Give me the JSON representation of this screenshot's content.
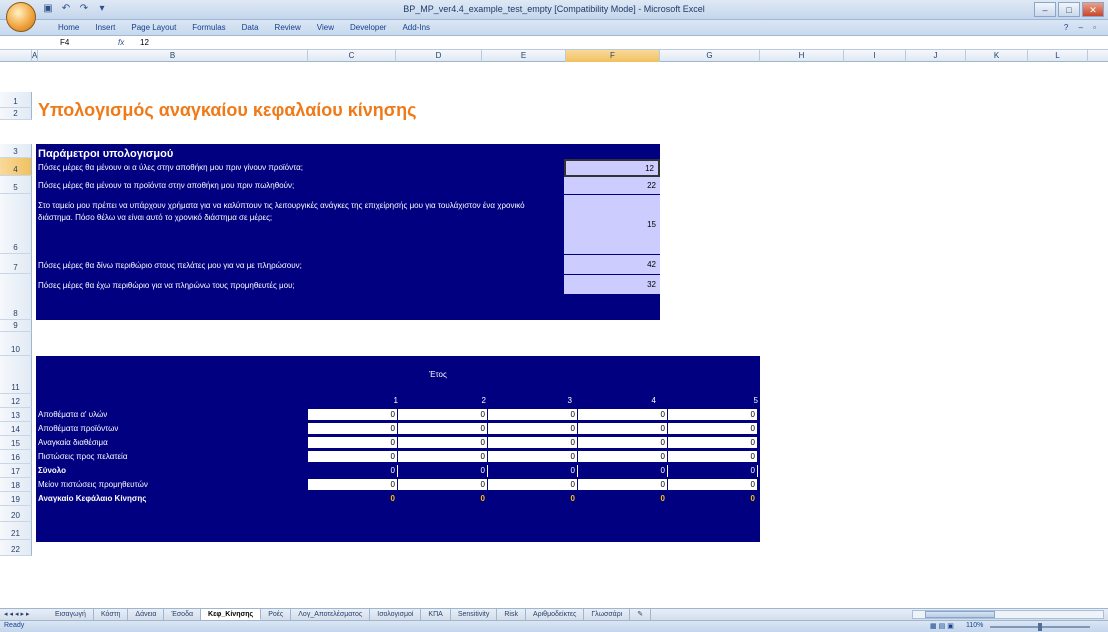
{
  "window": {
    "title": "BP_MP_ver4.4_example_test_empty  [Compatibility Mode] - Microsoft Excel"
  },
  "ribbon_tabs": [
    "Home",
    "Insert",
    "Page Layout",
    "Formulas",
    "Data",
    "Review",
    "View",
    "Developer",
    "Add-Ins"
  ],
  "formula_bar": {
    "cell_ref": "F4",
    "fx": "fx",
    "value": "12"
  },
  "columns": [
    "A",
    "B",
    "C",
    "D",
    "E",
    "F",
    "G",
    "H",
    "I",
    "J",
    "K",
    "L"
  ],
  "rows": [
    "1",
    "2",
    "3",
    "4",
    "5",
    "6",
    "7",
    "8",
    "9",
    "10",
    "11",
    "12",
    "13",
    "14",
    "15",
    "16",
    "17",
    "18",
    "19",
    "20",
    "21",
    "22"
  ],
  "sheet": {
    "title": "Υπολογισμός αναγκαίου κεφαλαίου κίνησης",
    "params_header": "Παράμετροι υπολογισμού",
    "params": [
      {
        "question": "Πόσες μέρες θα μένουν οι α ύλες στην αποθήκη μου πριν γίνουν προϊόντα;",
        "value": "12"
      },
      {
        "question": "Πόσες μέρες θα μένουν τα προϊόντα στην αποθήκη μου πριν πωληθούν;",
        "value": "22"
      },
      {
        "question": "Στο ταμείο μου πρέπει να υπάρχουν χρήματα για να καλύπτουν τις λειτουργικές ανάγκες της επιχείρησής μου για τουλάχιστον ένα χρονικό διάστημα. Πόσο θέλω να είναι αυτό το χρονικό διάστημα σε μέρες;",
        "value": "15"
      },
      {
        "question": "Πόσες μέρες  θα δίνω περιθώριο στους πελάτες μου για να με πληρώσουν;",
        "value": "42"
      },
      {
        "question": "Πόσες μέρες  θα έχω περιθώριο για να πληρώνω τους προμηθευτές μου;",
        "value": "32"
      }
    ],
    "year_title": "Έτος",
    "years": [
      "1",
      "2",
      "3",
      "4",
      "5"
    ],
    "table_rows": [
      {
        "label": "Αποθέματα α' υλών",
        "values": [
          "0",
          "0",
          "0",
          "0",
          "0"
        ],
        "style": "white"
      },
      {
        "label": "Αποθέματα προϊόντων",
        "values": [
          "0",
          "0",
          "0",
          "0",
          "0"
        ],
        "style": "white"
      },
      {
        "label": "Αναγκαία διαθέσιμα",
        "values": [
          "0",
          "0",
          "0",
          "0",
          "0"
        ],
        "style": "white"
      },
      {
        "label": "Πιστώσεις προς πελατεία",
        "values": [
          "0",
          "0",
          "0",
          "0",
          "0"
        ],
        "style": "white"
      },
      {
        "label": "Σύνολο",
        "values": [
          "0",
          "0",
          "0",
          "0",
          "0"
        ],
        "style": "navy"
      },
      {
        "label": "Μείον πιστώσεις προμηθευτών",
        "values": [
          "0",
          "0",
          "0",
          "0",
          "0"
        ],
        "style": "white"
      },
      {
        "label": "Αναγκαίο Κεφάλαιο Κίνησης",
        "values": [
          "0",
          "0",
          "0",
          "0",
          "0"
        ],
        "style": "gold"
      }
    ]
  },
  "sheet_tabs": [
    {
      "label": "Εισαγωγή",
      "active": false
    },
    {
      "label": "Κόστη",
      "active": false
    },
    {
      "label": "Δάνεια",
      "active": false
    },
    {
      "label": "Έσοδα",
      "active": false
    },
    {
      "label": "Κεφ_Κίνησης",
      "active": true
    },
    {
      "label": "Ροές",
      "active": false
    },
    {
      "label": "Λογ_Αποτελέσματος",
      "active": false
    },
    {
      "label": "Ισολογισμοί",
      "active": false
    },
    {
      "label": "ΚΠΑ",
      "active": false
    },
    {
      "label": "Sensitivity",
      "active": false
    },
    {
      "label": "Risk",
      "active": false
    },
    {
      "label": "Αριθμοδείκτες",
      "active": false
    },
    {
      "label": "Γλωσσάρι",
      "active": false
    }
  ],
  "status": {
    "text": "Ready",
    "zoom": "110%"
  },
  "colors": {
    "navy": "#000080",
    "title_orange": "#f07a18",
    "input_lilac": "#ccccff",
    "gold": "#ffc000"
  }
}
